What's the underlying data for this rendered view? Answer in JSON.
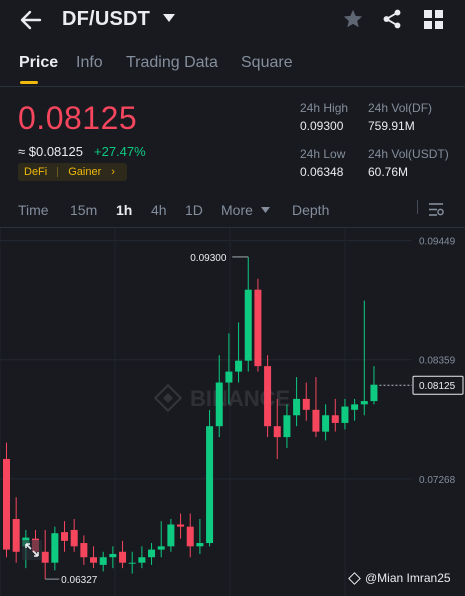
{
  "header": {
    "pair": "DF/USDT"
  },
  "tabs": [
    "Price",
    "Info",
    "Trading Data",
    "Square"
  ],
  "price": {
    "last": "0.08125",
    "approx": "≈ $0.08125",
    "change": "+27.47%",
    "badge_defi": "DeFi",
    "badge_gainer": "Gainer",
    "badge_arrow": "›"
  },
  "stats": {
    "high_label": "24h High",
    "high_value": "0.09300",
    "low_label": "24h Low",
    "low_value": "0.06348",
    "vol_df_label": "24h Vol(DF)",
    "vol_df_value": "759.91M",
    "vol_usdt_label": "24h Vol(USDT)",
    "vol_usdt_value": "60.76M"
  },
  "timeframes": {
    "time": "Time",
    "m15": "15m",
    "h1": "1h",
    "h4": "4h",
    "d1": "1D",
    "more": "More",
    "depth": "Depth"
  },
  "colors": {
    "up": "#0ecb81",
    "down": "#f6465d",
    "accent": "#f0b90b",
    "bg": "#181a20"
  },
  "chart_data": {
    "type": "candlestick",
    "ylim": [
      0.0625,
      0.0951
    ],
    "y_ticks": [
      "0.09449",
      "0.08359",
      "0.07268"
    ],
    "current_price_label": "0.08125",
    "current_price": 0.08125,
    "max_label": "0.09300",
    "min_label": "0.06327",
    "watermark": "BINANCE",
    "credit": "@Mian Imran25",
    "candles": [
      {
        "o": 0.0745,
        "h": 0.076,
        "l": 0.0655,
        "c": 0.0662
      },
      {
        "o": 0.069,
        "h": 0.071,
        "l": 0.065,
        "c": 0.066
      },
      {
        "o": 0.0665,
        "h": 0.068,
        "l": 0.0645,
        "c": 0.0673
      },
      {
        "o": 0.0672,
        "h": 0.068,
        "l": 0.0655,
        "c": 0.066
      },
      {
        "o": 0.066,
        "h": 0.068,
        "l": 0.0635,
        "c": 0.065
      },
      {
        "o": 0.065,
        "h": 0.0683,
        "l": 0.0643,
        "c": 0.0677
      },
      {
        "o": 0.0678,
        "h": 0.0688,
        "l": 0.066,
        "c": 0.067
      },
      {
        "o": 0.068,
        "h": 0.069,
        "l": 0.066,
        "c": 0.0665
      },
      {
        "o": 0.0668,
        "h": 0.0675,
        "l": 0.0648,
        "c": 0.0655
      },
      {
        "o": 0.0655,
        "h": 0.0665,
        "l": 0.0645,
        "c": 0.065
      },
      {
        "o": 0.0648,
        "h": 0.066,
        "l": 0.0642,
        "c": 0.0655
      },
      {
        "o": 0.0655,
        "h": 0.0665,
        "l": 0.0645,
        "c": 0.0658
      },
      {
        "o": 0.066,
        "h": 0.067,
        "l": 0.0645,
        "c": 0.065
      },
      {
        "o": 0.065,
        "h": 0.066,
        "l": 0.064,
        "c": 0.065
      },
      {
        "o": 0.065,
        "h": 0.0665,
        "l": 0.0645,
        "c": 0.0655
      },
      {
        "o": 0.0655,
        "h": 0.0668,
        "l": 0.0648,
        "c": 0.0662
      },
      {
        "o": 0.0662,
        "h": 0.0688,
        "l": 0.0655,
        "c": 0.0665
      },
      {
        "o": 0.0665,
        "h": 0.069,
        "l": 0.066,
        "c": 0.0685
      },
      {
        "o": 0.0685,
        "h": 0.0695,
        "l": 0.0672,
        "c": 0.0683
      },
      {
        "o": 0.0683,
        "h": 0.0695,
        "l": 0.0655,
        "c": 0.0665
      },
      {
        "o": 0.0665,
        "h": 0.069,
        "l": 0.0658,
        "c": 0.0668
      },
      {
        "o": 0.0668,
        "h": 0.079,
        "l": 0.0665,
        "c": 0.0775
      },
      {
        "o": 0.0775,
        "h": 0.084,
        "l": 0.0765,
        "c": 0.0815
      },
      {
        "o": 0.0815,
        "h": 0.086,
        "l": 0.0795,
        "c": 0.0825
      },
      {
        "o": 0.0825,
        "h": 0.087,
        "l": 0.0815,
        "c": 0.0835
      },
      {
        "o": 0.0835,
        "h": 0.093,
        "l": 0.0825,
        "c": 0.09
      },
      {
        "o": 0.09,
        "h": 0.091,
        "l": 0.0825,
        "c": 0.083
      },
      {
        "o": 0.083,
        "h": 0.084,
        "l": 0.0765,
        "c": 0.0775
      },
      {
        "o": 0.0775,
        "h": 0.08,
        "l": 0.0745,
        "c": 0.0765
      },
      {
        "o": 0.0765,
        "h": 0.0795,
        "l": 0.0755,
        "c": 0.0785
      },
      {
        "o": 0.0785,
        "h": 0.082,
        "l": 0.0775,
        "c": 0.08
      },
      {
        "o": 0.08,
        "h": 0.0815,
        "l": 0.078,
        "c": 0.079
      },
      {
        "o": 0.079,
        "h": 0.082,
        "l": 0.0765,
        "c": 0.077
      },
      {
        "o": 0.077,
        "h": 0.0795,
        "l": 0.0762,
        "c": 0.0785
      },
      {
        "o": 0.0785,
        "h": 0.08,
        "l": 0.077,
        "c": 0.0778
      },
      {
        "o": 0.0778,
        "h": 0.08,
        "l": 0.0772,
        "c": 0.0793
      },
      {
        "o": 0.079,
        "h": 0.08,
        "l": 0.078,
        "c": 0.0795
      },
      {
        "o": 0.0795,
        "h": 0.089,
        "l": 0.0785,
        "c": 0.0798
      },
      {
        "o": 0.0798,
        "h": 0.083,
        "l": 0.0795,
        "c": 0.0813
      }
    ]
  }
}
